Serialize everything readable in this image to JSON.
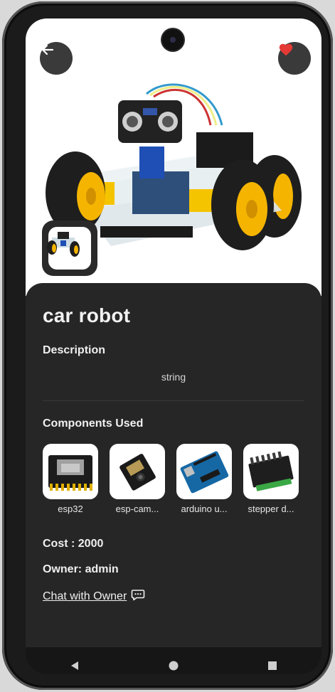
{
  "project": {
    "title": "car robot",
    "description_label": "Description",
    "description": "string",
    "components_label": "Components Used",
    "components": [
      {
        "name": "esp32",
        "icon": "esp32-board"
      },
      {
        "name": "esp-cam...",
        "icon": "esp-cam-board"
      },
      {
        "name": "arduino u...",
        "icon": "arduino-board"
      },
      {
        "name": "stepper d...",
        "icon": "stepper-driver"
      }
    ],
    "cost": "Cost : 2000",
    "owner": "Owner: admin",
    "chat_link": "Chat with Owner"
  },
  "colors": {
    "background": "#232323",
    "favorite": "#e53935",
    "text": "#f0f0f0"
  }
}
